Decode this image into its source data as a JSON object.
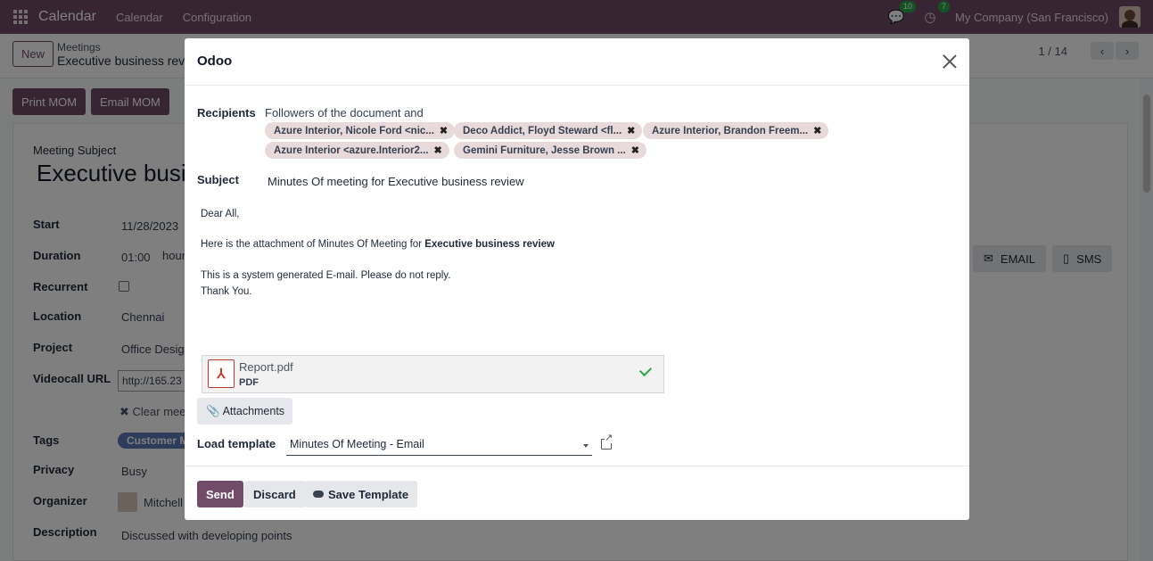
{
  "topnav": {
    "brand": "Calendar",
    "menu": [
      "Calendar",
      "Configuration"
    ],
    "messages_count": "10",
    "activities_count": "7",
    "company": "My Company (San Francisco)"
  },
  "control": {
    "new_label": "New",
    "breadcrumb_parent": "Meetings",
    "breadcrumb_current": "Executive business review",
    "pager": "1 / 14"
  },
  "actions": {
    "print_mom": "Print MOM",
    "email_mom": "Email MOM"
  },
  "form": {
    "subject_label": "Meeting Subject",
    "subject_value": "Executive business review",
    "start_label": "Start",
    "start_value": "11/28/2023",
    "duration_label": "Duration",
    "duration_value": "01:00",
    "duration_unit": "hours",
    "recurrent_label": "Recurrent",
    "location_label": "Location",
    "location_value": "Chennai",
    "project_label": "Project",
    "project_value": "Office Design",
    "videocall_label": "Videocall URL",
    "videocall_value": "http://165.23",
    "clear_meeting": "Clear meeting",
    "tags_label": "Tags",
    "tags_value": "Customer Meeting",
    "privacy_label": "Privacy",
    "privacy_value": "Busy",
    "organizer_label": "Organizer",
    "organizer_value": "Mitchell Admin",
    "description_label": "Description",
    "description_value": "Discussed with developing points",
    "email_btn": "EMAIL",
    "sms_btn": "SMS"
  },
  "modal": {
    "title": "Odoo",
    "recipients_label": "Recipients",
    "recipients_intro": "Followers of the document and",
    "recipients": [
      "Azure Interior, Nicole Ford <nic...",
      "Deco Addict, Floyd Steward <fl...",
      "Azure Interior, Brandon Freem...",
      "Azure Interior <azure.Interior2...",
      "Gemini Furniture, Jesse Brown ..."
    ],
    "subject_label": "Subject",
    "subject_value": "Minutes Of meeting for Executive business review",
    "body": {
      "greeting": "Dear All,",
      "line1_prefix": "Here is the attachment of Minutes Of Meeting for ",
      "line1_bold": "Executive business review",
      "line2": "This is a system generated E-mail. Please do not reply.",
      "line3": "Thank You."
    },
    "attachment": {
      "name": "Report.pdf",
      "type": "PDF"
    },
    "attachments_btn": "Attachments",
    "load_template_label": "Load template",
    "load_template_value": "Minutes Of Meeting - Email",
    "send_btn": "Send",
    "discard_btn": "Discard",
    "save_template_btn": "Save Template"
  }
}
